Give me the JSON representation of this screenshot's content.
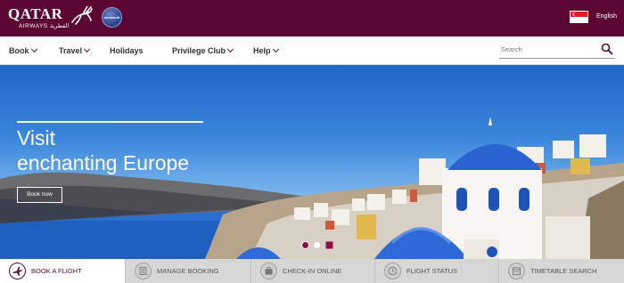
{
  "brand": {
    "logo_text": "QATAR",
    "logo_subtext": "AIRWAYS القطرية",
    "alliance_text": "oneworld",
    "language": "English",
    "colors": {
      "primary": "#5c0632",
      "hero_sky": "#3b86dc"
    }
  },
  "nav": {
    "items": [
      {
        "label": "Book",
        "has_dropdown": true
      },
      {
        "label": "Travel",
        "has_dropdown": true
      },
      {
        "label": "Holidays",
        "has_dropdown": false
      },
      {
        "label": "Privilege Club",
        "has_dropdown": true
      },
      {
        "label": "Help",
        "has_dropdown": true
      }
    ],
    "search": {
      "placeholder": "Search",
      "icon": "search-icon"
    }
  },
  "hero": {
    "title_line1": "Visit",
    "title_line2": "enchanting Europe",
    "cta_label": "Book now",
    "carousel": {
      "slides": 3,
      "active_index": 0
    }
  },
  "tabs": [
    {
      "label": "BOOK A FLIGHT",
      "icon": "airplane-icon",
      "active": true
    },
    {
      "label": "MANAGE BOOKING",
      "icon": "list-icon",
      "active": false
    },
    {
      "label": "CHECK-IN ONLINE",
      "icon": "briefcase-icon",
      "active": false
    },
    {
      "label": "FLIGHT STATUS",
      "icon": "clock-icon",
      "active": false
    },
    {
      "label": "TIMETABLE SEARCH",
      "icon": "calendar-icon",
      "active": false
    }
  ]
}
